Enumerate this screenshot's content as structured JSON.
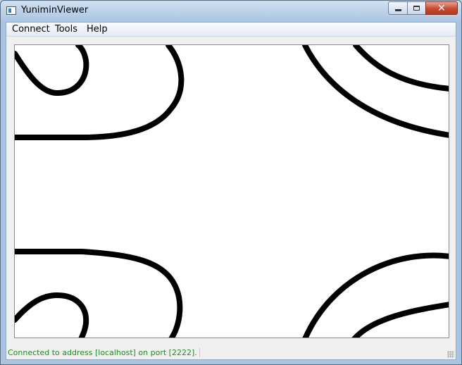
{
  "window": {
    "title": "YuniminViewer"
  },
  "menu": {
    "items": [
      "Connect",
      "Tools",
      "Help"
    ]
  },
  "status": {
    "text": "Connected to address [localhost] on port [2222]."
  },
  "icons": {
    "minimize": "minimize-icon",
    "maximize": "maximize-icon",
    "close": "close-icon"
  },
  "colors": {
    "status_text": "#1e8c1e",
    "canvas_background": "#ffffff",
    "curve": "#000000"
  }
}
